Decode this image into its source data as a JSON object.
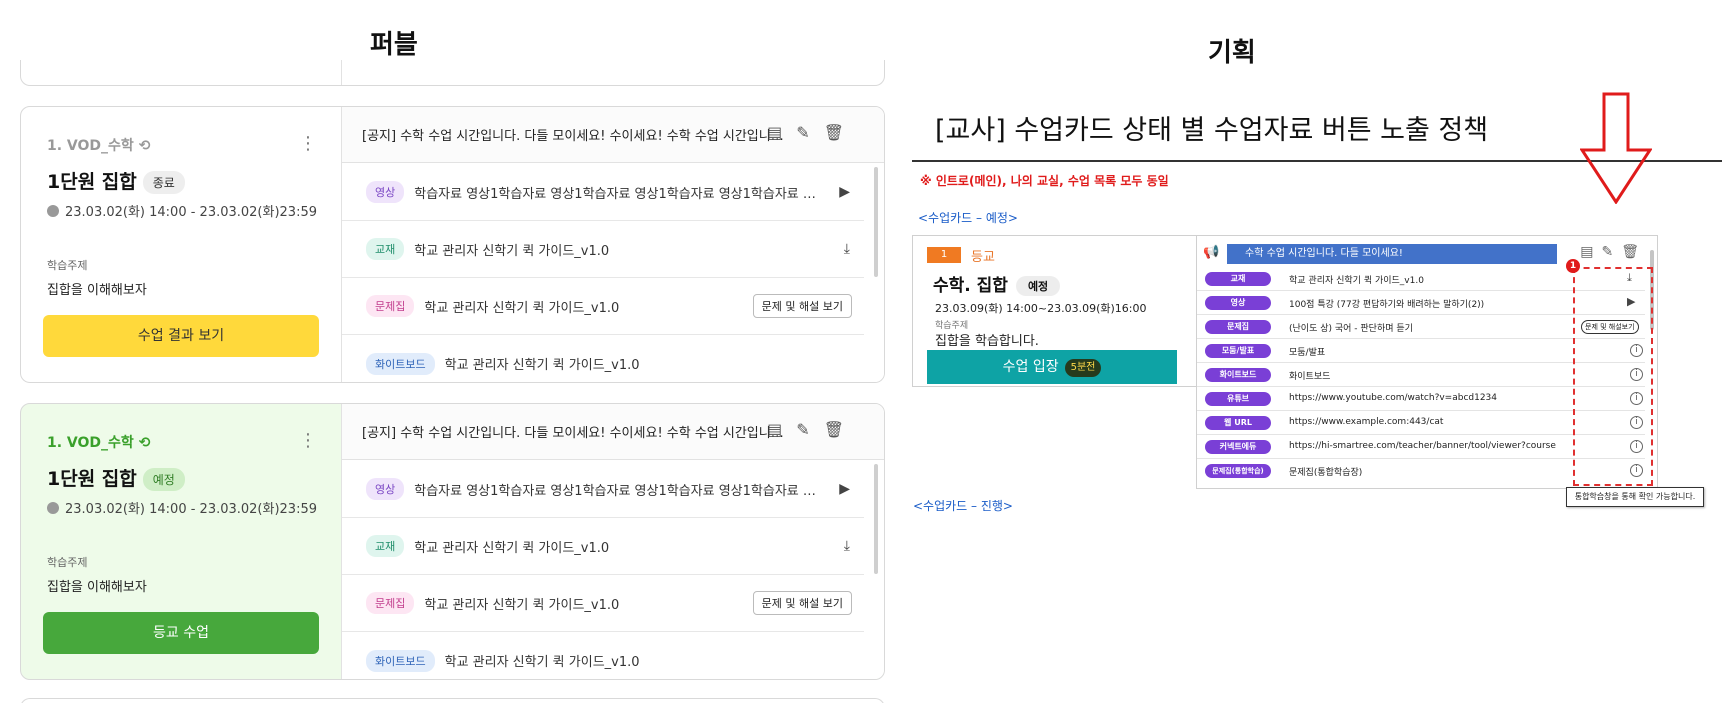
{
  "left_title": "퍼블",
  "right_title": "기획",
  "cards": [
    {
      "code": "1. VOD_수학",
      "title": "1단원 집합",
      "state": "종료",
      "date": "23.03.02(화) 14:00 - 23.03.02(화)23:59",
      "subject_label": "학습주제",
      "subject": "집합을 이해해보자",
      "button": "수업 결과 보기",
      "notice": "[공지] 수학 수업 시간입니다. 다들 모이세요! 수이세요! 수학 수업 시간입니…",
      "materials": [
        {
          "tag": "영상",
          "text": "학습자료 영상1학습자료 영상1학습자료 영상1학습자료 영상1학습자료 영상1"
        },
        {
          "tag": "교재",
          "text": "학교 관리자 신학기 퀵 가이드_v1.0"
        },
        {
          "tag": "문제집",
          "text": "학교 관리자 신학기 퀵 가이드_v1.0",
          "button": "문제 및 해설 보기"
        },
        {
          "tag": "화이트보드",
          "text": "학교 관리자 신학기 퀵 가이드_v1.0"
        }
      ]
    },
    {
      "code": "1. VOD_수학",
      "title": "1단원 집합",
      "state": "예정",
      "date": "23.03.02(화) 14:00 - 23.03.02(화)23:59",
      "subject_label": "학습주제",
      "subject": "집합을 이해해보자",
      "button": "등교 수업",
      "notice": "[공지] 수학 수업 시간입니다. 다들 모이세요! 수이세요! 수학 수업 시간입니…",
      "materials": [
        {
          "tag": "영상",
          "text": "학습자료 영상1학습자료 영상1학습자료 영상1학습자료 영상1학습자료 영상1"
        },
        {
          "tag": "교재",
          "text": "학교 관리자 신학기 퀵 가이드_v1.0"
        },
        {
          "tag": "문제집",
          "text": "학교 관리자 신학기 퀵 가이드_v1.0",
          "button": "문제 및 해설 보기"
        },
        {
          "tag": "화이트보드",
          "text": "학교 관리자 신학기 퀵 가이드_v1.0"
        }
      ]
    }
  ],
  "plan": {
    "title": "[교사] 수업카드 상태 별 수업자료 버튼 노출 정책",
    "note": "※ 인트로(메인), 나의 교실, 수업 목록 모두 동일",
    "section_scheduled": "<수업카드 – 예정>",
    "section_progress": "<수업카드 – 진행>",
    "mini_card": {
      "num": "1",
      "state": "등교",
      "title": "수학. 집합",
      "badge": "예정",
      "date": "23.03.09(화) 14:00~23.03.09(화)16:00",
      "subject_label": "학습주제",
      "subject": "집합을 학습합니다.",
      "button": "수업 입장",
      "button_badge": "5분전"
    },
    "panel": {
      "notice": "수학 수업 시간입니다. 다들 모이세요!",
      "rows": [
        {
          "tag": "교재",
          "text": "학교 관리자 신학기 퀵 가이드_v1.0",
          "action": "download"
        },
        {
          "tag": "영상",
          "text": "100점 특강 (77강 편답하기와 배려하는 말하기(2))",
          "action": "play"
        },
        {
          "tag": "문제집",
          "text": "(난이도 상) 국어 - 판단하며 듣기",
          "action": "button",
          "button": "문제 및 해설보기"
        },
        {
          "tag": "모둠/발표",
          "text": "모둠/발표",
          "action": "info"
        },
        {
          "tag": "화이트보드",
          "text": "화이트보드",
          "action": "info"
        },
        {
          "tag": "유튜브",
          "text": "https://www.youtube.com/watch?v=abcd1234",
          "action": "info"
        },
        {
          "tag": "웹 URL",
          "text": "https://www.example.com:443/cat",
          "action": "info"
        },
        {
          "tag": "커넥트에듀",
          "text": "https://hi-smartree.com/teacher/banner/tool/viewer?course",
          "action": "info"
        },
        {
          "tag": "문제집(통합학습)",
          "text": "문제집(통합학습장)",
          "action": "info"
        }
      ],
      "marker": "1",
      "tooltip": "통합학습창을 통해 확인 가능합니다."
    }
  }
}
